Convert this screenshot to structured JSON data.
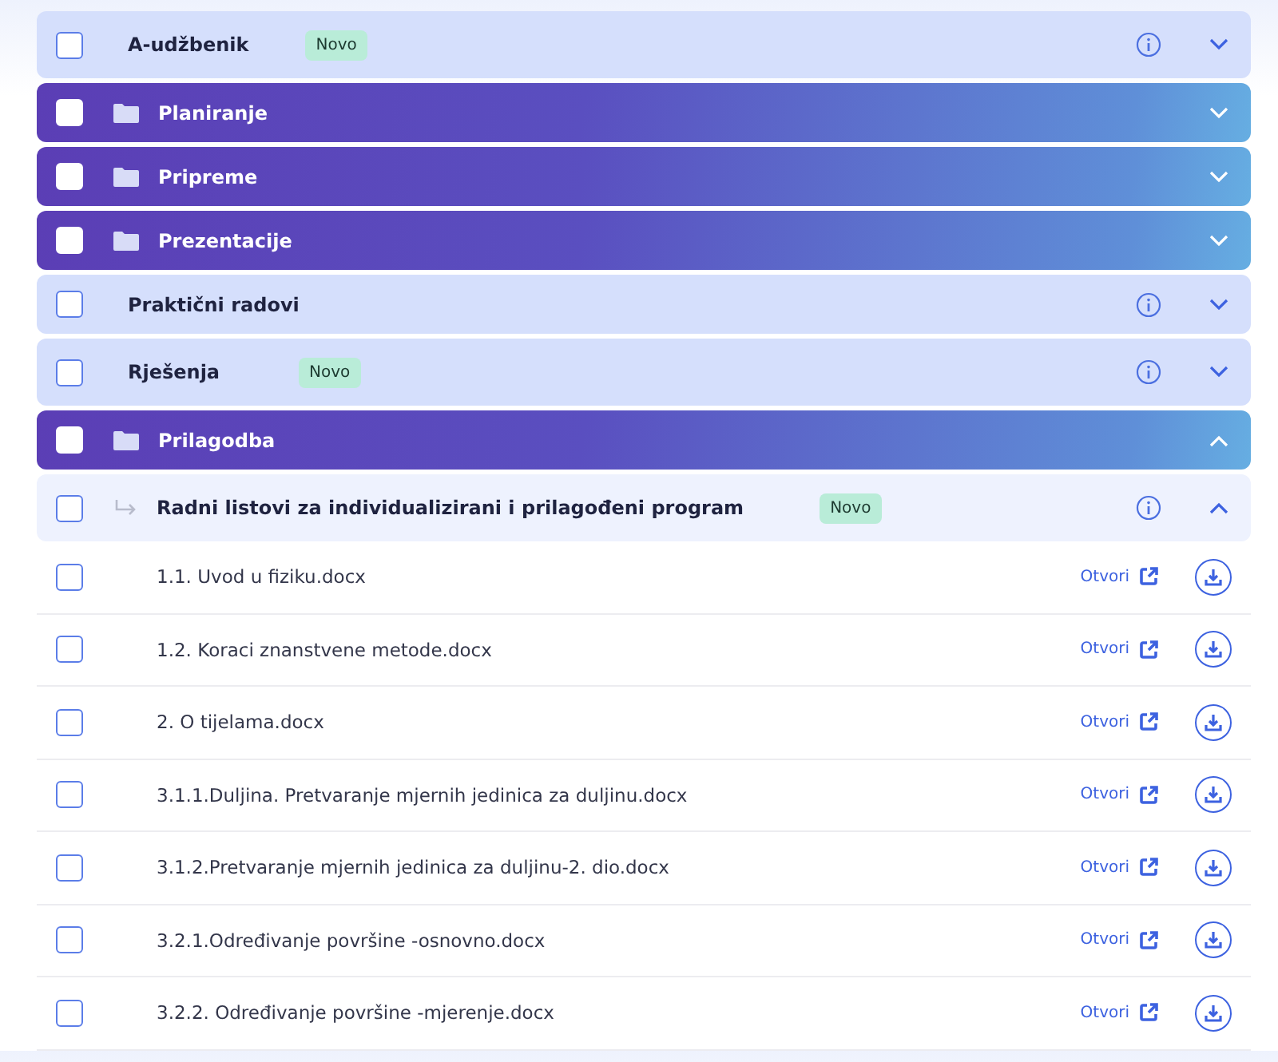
{
  "sections": [
    {
      "kind": "plain",
      "title": "A-udžbenik",
      "badge": "Novo",
      "checked": false,
      "expanded": false,
      "info": true
    },
    {
      "kind": "folder",
      "title": "Planiranje",
      "checked": false,
      "expanded": false
    },
    {
      "kind": "folder",
      "title": "Pripreme",
      "checked": false,
      "expanded": false
    },
    {
      "kind": "folder",
      "title": "Prezentacije",
      "checked": false,
      "expanded": false
    },
    {
      "kind": "plain",
      "title": "Praktični radovi",
      "checked": false,
      "expanded": false,
      "info": true
    },
    {
      "kind": "plain",
      "title": "Rješenja",
      "badge": "Novo",
      "checked": false,
      "expanded": false,
      "info": true
    },
    {
      "kind": "folder",
      "title": "Prilagodba",
      "checked": false,
      "expanded": true
    },
    {
      "kind": "subfolder",
      "title": "Radni listovi za individualizirani i prilagođeni program",
      "badge": "Novo",
      "checked": false,
      "expanded": true,
      "info": true
    }
  ],
  "files": [
    {
      "name": "1.1. Uvod u fiziku.docx",
      "open": "Otvori",
      "checked": false
    },
    {
      "name": "1.2. Koraci znanstvene metode.docx",
      "open": "Otvori",
      "checked": false
    },
    {
      "name": "2. O tijelama.docx",
      "open": "Otvori",
      "checked": false
    },
    {
      "name": "3.1.1.Duljina. Pretvaranje mjernih jedinica za duljinu.docx",
      "open": "Otvori",
      "checked": false
    },
    {
      "name": "3.1.2.Pretvaranje mjernih jedinica za duljinu-2. dio.docx",
      "open": "Otvori",
      "checked": false
    },
    {
      "name": "3.2.1.Određivanje površine -osnovno.docx",
      "open": "Otvori",
      "checked": false
    },
    {
      "name": "3.2.2. Određivanje površine -mjerenje.docx",
      "open": "Otvori",
      "checked": false
    }
  ]
}
